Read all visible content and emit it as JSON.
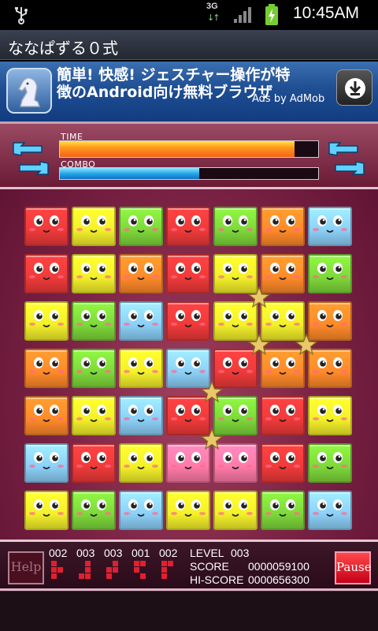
{
  "status_bar": {
    "network": "3G",
    "time": "10:45AM"
  },
  "app": {
    "title": "ななぱずる０式"
  },
  "ad": {
    "text": "簡単! 快感! ジェスチャー操作が特徴のAndroid向け無料ブラウザ",
    "attribution": "Ads by AdMob",
    "icons": [
      "chess-knight-icon",
      "download-icon"
    ]
  },
  "hud": {
    "time_label": "TIME",
    "combo_label": "COMBO",
    "time_fill": 0.91,
    "combo_fill": 0.54,
    "icons": [
      "swap-arrows-icon"
    ]
  },
  "colors": {
    "red": "#f03a3a",
    "yellow": "#f4f02a",
    "green": "#7ed83a",
    "orange": "#ff8a2a",
    "blue": "#8cd0f8",
    "pink": "#ff7aa8"
  },
  "board": [
    [
      "red",
      "yellow",
      "green",
      "red",
      "green",
      "orange",
      "blue"
    ],
    [
      "red",
      "yellow",
      "orange",
      "red",
      "yellow",
      "orange",
      "green"
    ],
    [
      "yellow",
      "green",
      "blue",
      "red",
      "yellow",
      "yellow",
      "orange"
    ],
    [
      "orange",
      "green",
      "yellow",
      "blue",
      "red",
      "orange",
      "orange"
    ],
    [
      "orange",
      "yellow",
      "blue",
      "red",
      "green",
      "red",
      "yellow"
    ],
    [
      "blue",
      "red",
      "yellow",
      "pink",
      "pink",
      "red",
      "green"
    ],
    [
      "yellow",
      "green",
      "blue",
      "yellow",
      "yellow",
      "green",
      "blue"
    ]
  ],
  "stars_at": [
    [
      2,
      5
    ],
    [
      3,
      5
    ],
    [
      3,
      6
    ],
    [
      4,
      4
    ],
    [
      5,
      4
    ]
  ],
  "footer": {
    "help_label": "Help",
    "pause_label": "Pause",
    "counts": [
      "002",
      "003",
      "003",
      "001",
      "002"
    ],
    "level_label": "LEVEL",
    "level_value": "003",
    "score_label": "SCORE",
    "score_value": "0000059100",
    "hiscore_label": "HI-SCORE",
    "hiscore_value": "0000656300"
  }
}
